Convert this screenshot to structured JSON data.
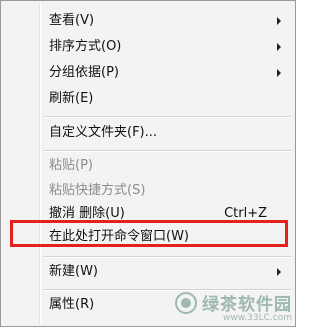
{
  "menu": {
    "items": [
      {
        "label": "查看(V)",
        "submenu": true
      },
      {
        "label": "排序方式(O)",
        "submenu": true
      },
      {
        "label": "分组依据(P)",
        "submenu": true
      },
      {
        "label": "刷新(E)"
      },
      {
        "label": "自定义文件夹(F)..."
      },
      {
        "label": "粘贴(P)",
        "disabled": true
      },
      {
        "label": "粘贴快捷方式(S)",
        "disabled": true
      },
      {
        "label": "撤消 删除(U)",
        "shortcut": "Ctrl+Z"
      },
      {
        "label": "在此处打开命令窗口(W)",
        "highlighted": true
      },
      {
        "label": "新建(W)",
        "submenu": true
      },
      {
        "label": "属性(R)"
      }
    ]
  },
  "annotation": {
    "color": "#e5211d"
  },
  "watermark": {
    "name": "绿茶软件园",
    "url": "www.33LC.com"
  }
}
